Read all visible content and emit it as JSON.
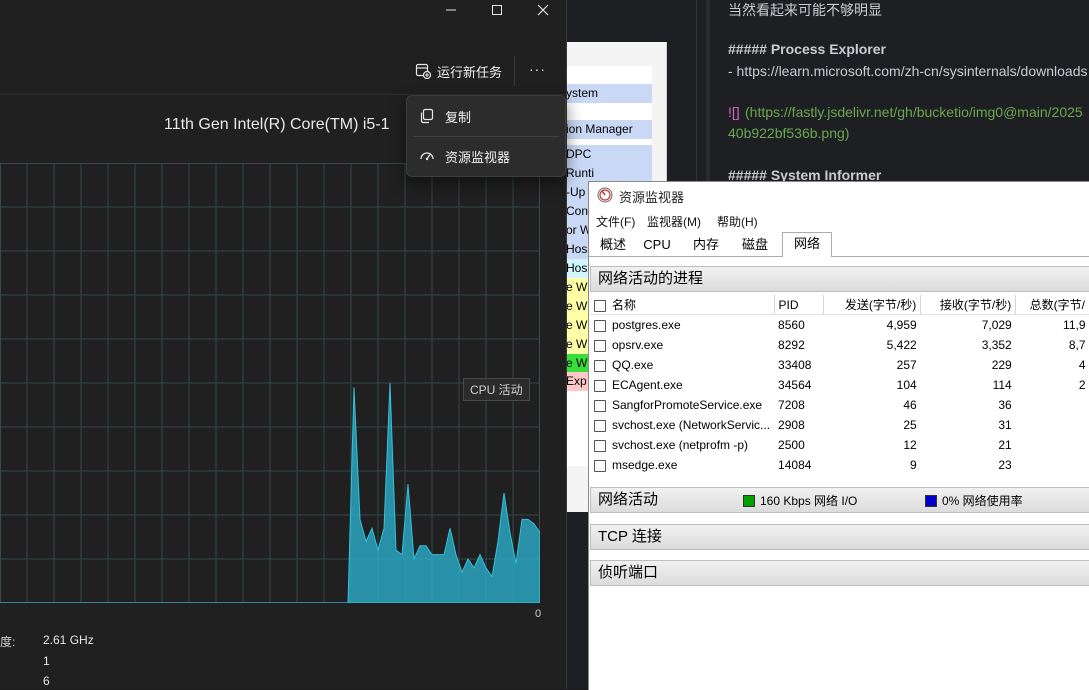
{
  "markdown": {
    "lines": [
      "当然看起来可能不够明显",
      "##### Process Explorer",
      "- https://learn.microsoft.com/zh-cn/sysinternals/downloads",
      "![]",
      "(https://fastly.jsdelivr.net/gh/bucketio/img0@main/2025",
      "40b922bf536b.png)",
      "##### System Informer"
    ]
  },
  "background_window": {
    "rows": [
      "ystem",
      "ion Manager",
      "DPC",
      "Runti",
      "-Up",
      "Contr",
      "or W",
      "Hos",
      "Hos",
      "e W",
      "e W",
      "e W",
      "e W",
      "e W",
      "Exp"
    ],
    "row_colors": [
      "#c9d8f4",
      "#c9d8f4",
      "#c9d8f4",
      "#c9d8f4",
      "#c9d8f4",
      "#c9d8f4",
      "#c9d8f4",
      "#c9d8f4",
      "#d2f6ff",
      "#ffffa8",
      "#ffffa8",
      "#ffffa8",
      "#ffffa8",
      "#3ade3a",
      "#ffc8c8"
    ]
  },
  "task_manager": {
    "toolbar": {
      "run_new_task": "运行新任务",
      "more": "···"
    },
    "cpu_name": "11th Gen Intel(R) Core(TM) i5-1",
    "tooltip": "CPU 活动",
    "axis_zero": "0",
    "stats": [
      {
        "label": "度:",
        "value": "2.61 GHz"
      },
      {
        "label": "",
        "value": "1"
      },
      {
        "label": "",
        "value": "6"
      }
    ],
    "context_menu": {
      "copy": "复制",
      "resource_monitor": "资源监视器"
    },
    "accent": "#2aa6c0"
  },
  "chart_data": {
    "type": "area",
    "title": "",
    "xlabel": "",
    "ylabel": "",
    "ylim": [
      0,
      100
    ],
    "values": [
      0,
      0,
      0,
      0,
      0,
      0,
      0,
      0,
      0,
      0,
      0,
      0,
      0,
      0,
      0,
      0,
      0,
      0,
      0,
      0,
      0,
      0,
      0,
      0,
      0,
      0,
      0,
      0,
      0,
      0,
      0,
      0,
      0,
      0,
      0,
      0,
      0,
      0,
      0,
      0,
      0,
      0,
      0,
      0,
      0,
      0,
      0,
      0,
      0,
      0,
      0,
      0,
      0,
      0,
      0,
      0,
      0,
      0,
      0,
      49,
      19,
      14,
      17,
      12,
      17,
      50,
      12,
      11,
      27,
      10,
      13,
      13,
      11,
      11,
      11,
      17,
      11,
      7,
      10,
      8,
      11,
      8,
      6,
      14,
      25,
      16,
      9,
      19,
      19,
      18,
      16
    ]
  },
  "resource_monitor": {
    "title": "资源监视器",
    "menu": [
      "文件(F)",
      "监视器(M)",
      "帮助(H)"
    ],
    "tabs": [
      "概述",
      "CPU",
      "内存",
      "磁盘",
      "网络"
    ],
    "active_tab": "网络",
    "sections": {
      "processes": "网络活动的进程",
      "network_activity": "网络活动",
      "tcp": "TCP 连接",
      "listening": "侦听端口"
    },
    "columns": [
      "名称",
      "PID",
      "发送(字节/秒)",
      "接收(字节/秒)",
      "总数(字节/"
    ],
    "rows": [
      {
        "name": "postgres.exe",
        "pid": "8560",
        "send": "4,959",
        "recv": "7,029",
        "total": "11,9"
      },
      {
        "name": "opsrv.exe",
        "pid": "8292",
        "send": "5,422",
        "recv": "3,352",
        "total": "8,7"
      },
      {
        "name": "QQ.exe",
        "pid": "33408",
        "send": "257",
        "recv": "229",
        "total": "4"
      },
      {
        "name": "ECAgent.exe",
        "pid": "34564",
        "send": "104",
        "recv": "114",
        "total": "2"
      },
      {
        "name": "SangforPromoteService.exe",
        "pid": "7208",
        "send": "46",
        "recv": "36",
        "total": ""
      },
      {
        "name": "svchost.exe (NetworkServic...",
        "pid": "2908",
        "send": "25",
        "recv": "31",
        "total": ""
      },
      {
        "name": "svchost.exe (netprofm -p)",
        "pid": "2500",
        "send": "12",
        "recv": "21",
        "total": ""
      },
      {
        "name": "msedge.exe",
        "pid": "14084",
        "send": "9",
        "recv": "23",
        "total": ""
      }
    ],
    "network_io": "160 Kbps 网络 I/O",
    "network_usage": "0% 网络使用率",
    "io_color": "#00a000",
    "usage_color": "#0000c8"
  }
}
